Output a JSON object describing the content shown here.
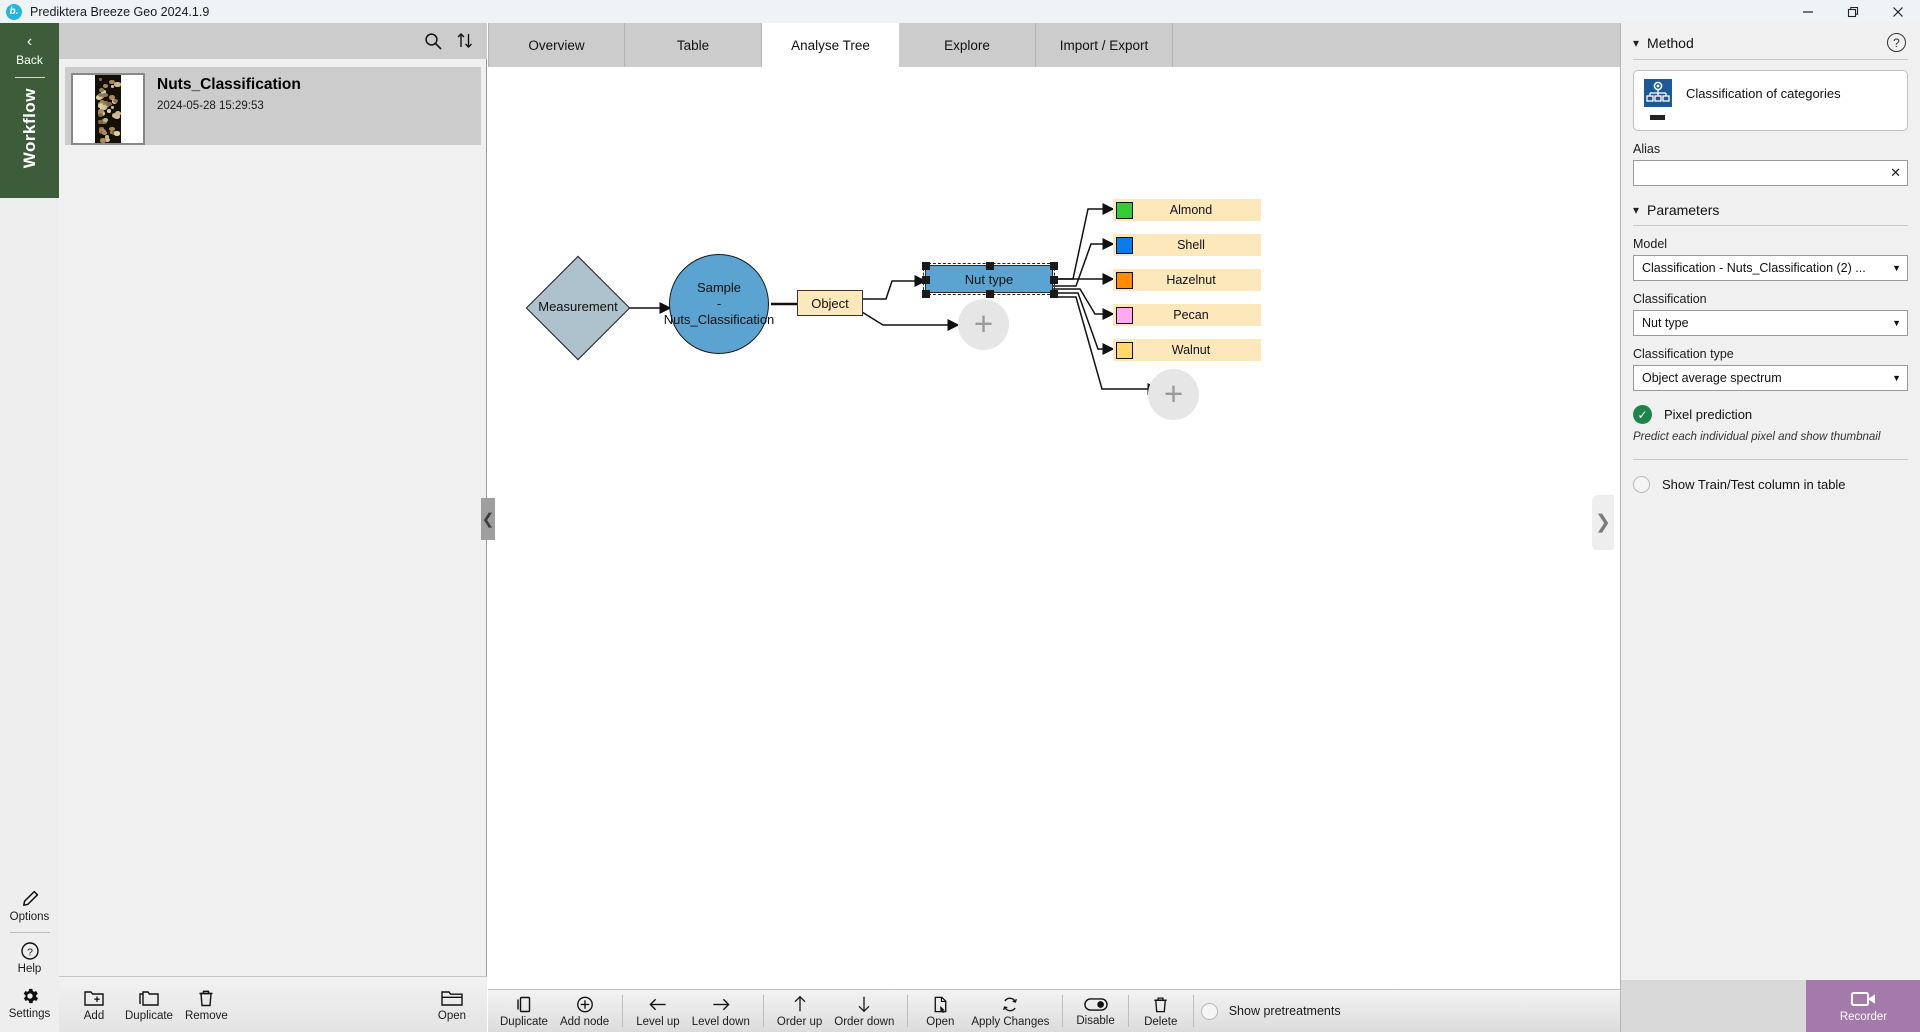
{
  "window": {
    "title": "Prediktera Breeze Geo 2024.1.9",
    "minimize": "—",
    "maximize": "❐",
    "close": "✕"
  },
  "rail": {
    "back_chevron": "‹",
    "back_label": "Back",
    "vertical_label": "Workflow",
    "items": [
      {
        "icon": "pencil-icon",
        "label": "Options"
      },
      {
        "icon": "question-circle-icon",
        "label": "Help"
      },
      {
        "icon": "gear-icon",
        "label": "Settings"
      }
    ]
  },
  "left_panel": {
    "toolbar": {
      "search_icon": "search-icon",
      "sort_icon": "sort-icon"
    },
    "card": {
      "title": "Nuts_Classification",
      "date": "2024-05-28 15:29:53",
      "thumbnail": "nuts-sample-thumbnail"
    },
    "bottom_buttons": [
      {
        "icon": "folder-add-icon",
        "label": "Add"
      },
      {
        "icon": "folder-copy-icon",
        "label": "Duplicate"
      },
      {
        "icon": "trash-icon",
        "label": "Remove"
      }
    ],
    "open_button": {
      "icon": "folder-open-icon",
      "label": "Open"
    }
  },
  "tabs": [
    {
      "label": "Overview",
      "active": false
    },
    {
      "label": "Table",
      "active": false
    },
    {
      "label": "Analyse Tree",
      "active": true
    },
    {
      "label": "Explore",
      "active": false
    },
    {
      "label": "Import / Export",
      "active": false
    }
  ],
  "canvas": {
    "collapse_left_icon": "chevron-left-icon",
    "collapse_right_icon": "chevron-right-icon",
    "nodes": {
      "measurement": {
        "label": "Measurement",
        "shape": "diamond",
        "color": "#adc2cc"
      },
      "sample": {
        "line1": "Sample",
        "line2": "-",
        "line3": "Nuts_Classification",
        "shape": "circle",
        "color": "#5ba3d0"
      },
      "object": {
        "label": "Object",
        "shape": "rect",
        "color": "#fde8bc"
      },
      "nut_type": {
        "label": "Nut type",
        "shape": "rect-selected",
        "color": "#5ba3d0"
      },
      "add_node_1": {
        "label": "+",
        "shape": "circle-add"
      },
      "add_node_2": {
        "label": "+",
        "shape": "circle-add"
      }
    },
    "classes": [
      {
        "label": "Almond",
        "color": "#33cc33"
      },
      {
        "label": "Shell",
        "color": "#0a7cf0"
      },
      {
        "label": "Hazelnut",
        "color": "#ff8c00"
      },
      {
        "label": "Pecan",
        "color": "#ffaaee"
      },
      {
        "label": "Walnut",
        "color": "#ffd966"
      }
    ]
  },
  "canvas_toolbar": {
    "groups": [
      [
        {
          "icon": "duplicate-icon",
          "label": "Duplicate"
        },
        {
          "icon": "plus-circle-icon",
          "label": "Add node"
        }
      ],
      [
        {
          "icon": "arrow-left-icon",
          "label": "Level up"
        },
        {
          "icon": "arrow-right-icon",
          "label": "Level down"
        }
      ],
      [
        {
          "icon": "arrow-up-icon",
          "label": "Order up"
        },
        {
          "icon": "arrow-down-icon",
          "label": "Order down"
        }
      ],
      [
        {
          "icon": "document-open-icon",
          "label": "Open"
        },
        {
          "icon": "refresh-icon",
          "label": "Apply Changes"
        }
      ],
      [
        {
          "icon": "toggle-icon",
          "label": "Disable"
        }
      ],
      [
        {
          "icon": "trash-icon",
          "label": "Delete"
        }
      ]
    ],
    "show_pretreatments": {
      "label": "Show pretreatments",
      "checked": false
    }
  },
  "recorder": {
    "icon": "video-camera-icon",
    "label": "Recorder",
    "color": "#a47aaa"
  },
  "right_panel": {
    "method": {
      "section_title": "Method",
      "help_icon": "question-mark-icon",
      "card_name": "Classification of categories",
      "card_icon": "hierarchy-icon",
      "alias_label": "Alias",
      "alias_value": "",
      "alias_placeholder": "",
      "clear_icon": "close-icon"
    },
    "parameters": {
      "section_title": "Parameters",
      "model_label": "Model",
      "model_value": "Classification - Nuts_Classification (2) ...",
      "classification_label": "Classification",
      "classification_value": "Nut type",
      "classification_type_label": "Classification type",
      "classification_type_value": "Object average spectrum",
      "pixel_prediction": {
        "label": "Pixel prediction",
        "checked": true,
        "hint": "Predict each individual pixel and show thumbnail"
      },
      "show_train_test": {
        "label": "Show Train/Test column in table",
        "checked": false
      }
    }
  }
}
